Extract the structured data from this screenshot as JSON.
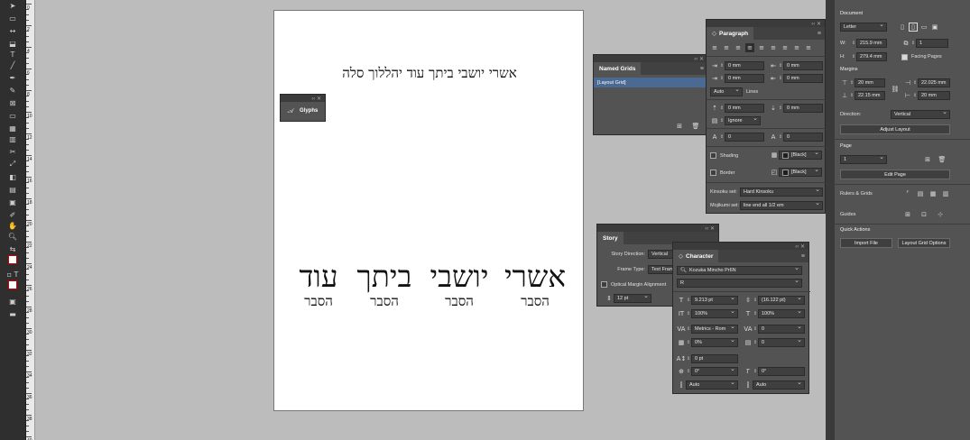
{
  "page": {
    "heading": "אשרי יושבי ביתך עוד יהללוך סלה",
    "words": [
      {
        "big": "אשרי",
        "small": "הסבר"
      },
      {
        "big": "יושבי",
        "small": "הסבר"
      },
      {
        "big": "ביתך",
        "small": "הסבר"
      },
      {
        "big": "עוד",
        "small": "הסבר"
      }
    ]
  },
  "glyphs": {
    "title": "Glyphs"
  },
  "named_grids": {
    "title": "Named Grids",
    "item": "[Layout Grid]"
  },
  "paragraph": {
    "title": "Paragraph",
    "left_indent": "0 mm",
    "right_indent": "0 mm",
    "first_line": "0 mm",
    "last_line": "0 mm",
    "leading_mode": "Auto",
    "leading_unit": "Lines",
    "space_before": "0 mm",
    "space_after": "0 mm",
    "align_grid": "Ignore",
    "drop_lines": "0",
    "drop_chars": "0",
    "shading_label": "Shading",
    "border_label": "Border",
    "shading_color": "[Black]",
    "border_color": "[Black]",
    "kinsoku_label": "Kinsoku set:",
    "kinsoku_value": "Hard Kinsoku",
    "mojikumi_label": "Mojikumi set:",
    "mojikumi_value": "line end all 1/2 em"
  },
  "story": {
    "title": "Story",
    "direction_label": "Story Direction:",
    "direction_value": "Vertical",
    "frame_label": "Frame Type:",
    "frame_value": "Text Fram",
    "optical_label": "Optical Margin Alignment",
    "size_value": "12 pt"
  },
  "character": {
    "title": "Character",
    "font": "Kozuka Mincho Pr6N",
    "style": "R",
    "size": "9.213 pt",
    "leading": "(16.122 pt)",
    "v_scale": "100%",
    "h_scale": "100%",
    "kerning": "Metrics - Rom",
    "tracking": "0",
    "tsume": "0%",
    "aki": "0",
    "baseline": "0 pt",
    "rotate": "0°",
    "skew": "0°",
    "aki_before": "Auto",
    "aki_after": "Auto"
  },
  "properties": {
    "document_label": "Document",
    "size_preset": "Letter",
    "width_label": "W:",
    "width_value": "215.9 mm",
    "height_label": "H:",
    "height_value": "279.4 mm",
    "pages_value": "1",
    "facing_label": "Facing Pages",
    "margins_label": "Margins",
    "margin_top": "20 mm",
    "margin_bottom": "22.15 mm",
    "margin_inside": "22.025 mm",
    "margin_outside": "20 mm",
    "direction_label": "Direction:",
    "direction_value": "Vertical",
    "adjust_button": "Adjust Layout",
    "page_label": "Page",
    "page_value": "1",
    "edit_page_button": "Edit Page",
    "rulers_label": "Rulers & Grids",
    "guides_label": "Guides",
    "quick_label": "Quick Actions",
    "import_button": "Import File",
    "grid_options_button": "Layout Grid Options"
  },
  "ruler": {
    "numbers": [
      "0",
      "2",
      "4",
      "6",
      "8",
      "10",
      "12",
      "14",
      "16",
      "18",
      "20",
      "22",
      "24",
      "26",
      "28",
      "30",
      "32",
      "34",
      "36",
      "38",
      "40"
    ]
  }
}
